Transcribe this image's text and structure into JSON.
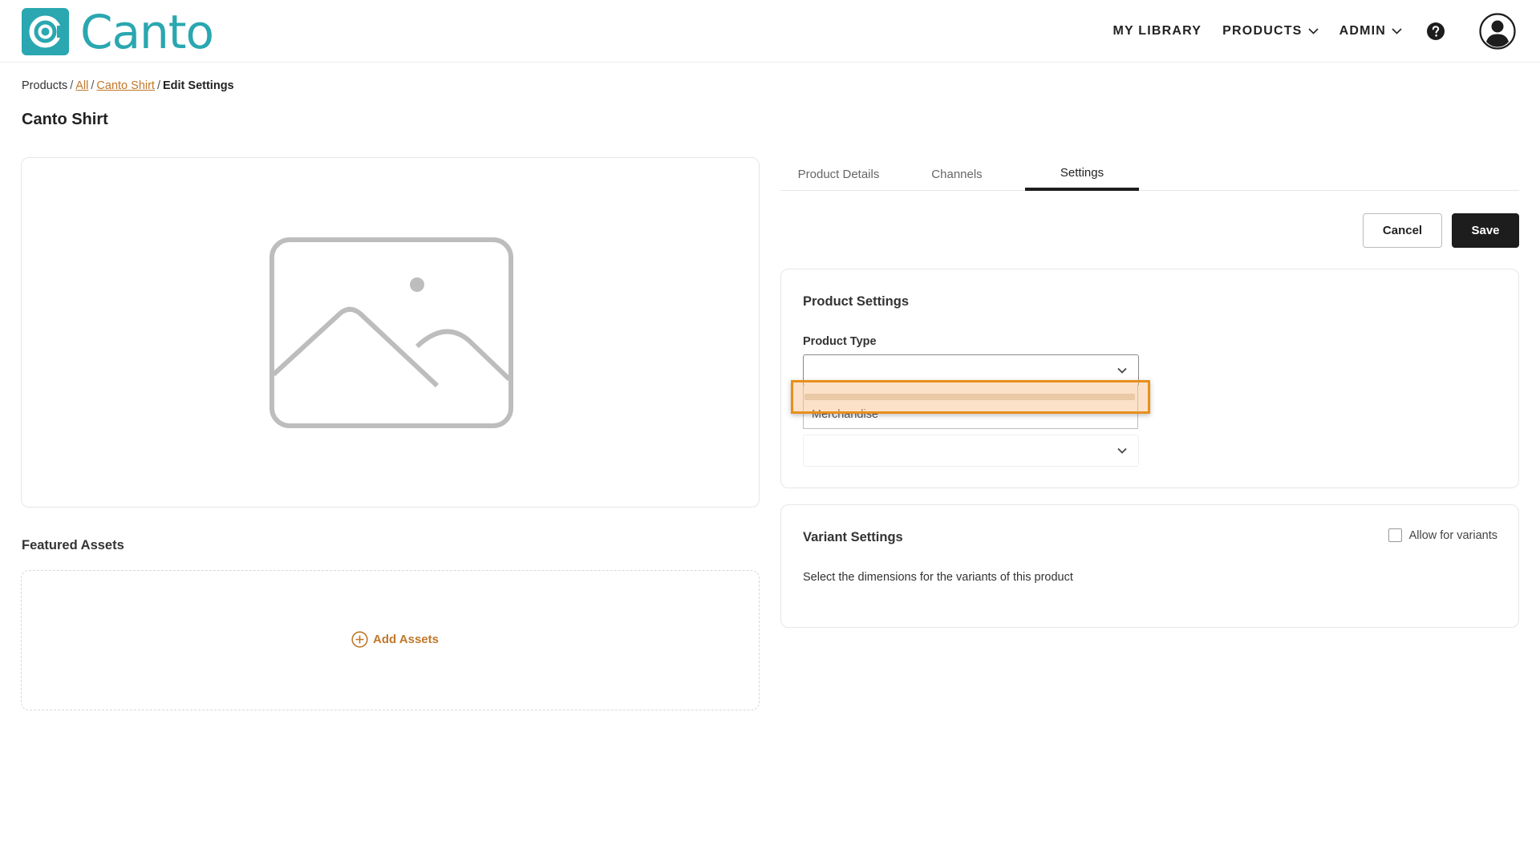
{
  "brand": {
    "name": "Canto",
    "color": "#2aa7b0"
  },
  "nav": {
    "items": [
      {
        "label": "MY LIBRARY",
        "dropdown": false
      },
      {
        "label": "PRODUCTS",
        "dropdown": true
      },
      {
        "label": "ADMIN",
        "dropdown": true
      }
    ],
    "help_icon": "question-circle-icon",
    "avatar_icon": "user-circle-icon"
  },
  "breadcrumb": {
    "root": "Products",
    "all": "All",
    "product": "Canto Shirt",
    "current": "Edit Settings"
  },
  "page": {
    "title": "Canto Shirt"
  },
  "media": {
    "placeholder_icon": "image-placeholder-icon",
    "featured_title": "Featured Assets",
    "add_assets_label": "Add Assets",
    "accent": "#c0782a"
  },
  "tabs": [
    {
      "label": "Product Details",
      "active": false
    },
    {
      "label": "Channels",
      "active": false
    },
    {
      "label": "Settings",
      "active": true
    }
  ],
  "actions": {
    "cancel": "Cancel",
    "save": "Save"
  },
  "product_settings": {
    "title": "Product Settings",
    "product_type_label": "Product Type",
    "product_type_value": "",
    "dropdown_options": [
      "Merchandise"
    ],
    "second_select_value": ""
  },
  "variant_settings": {
    "title": "Variant Settings",
    "allow_variants_label": "Allow for variants",
    "allow_variants_checked": false,
    "description": "Select the dimensions for the variants of this product"
  },
  "highlight_color": "#e88f1c"
}
